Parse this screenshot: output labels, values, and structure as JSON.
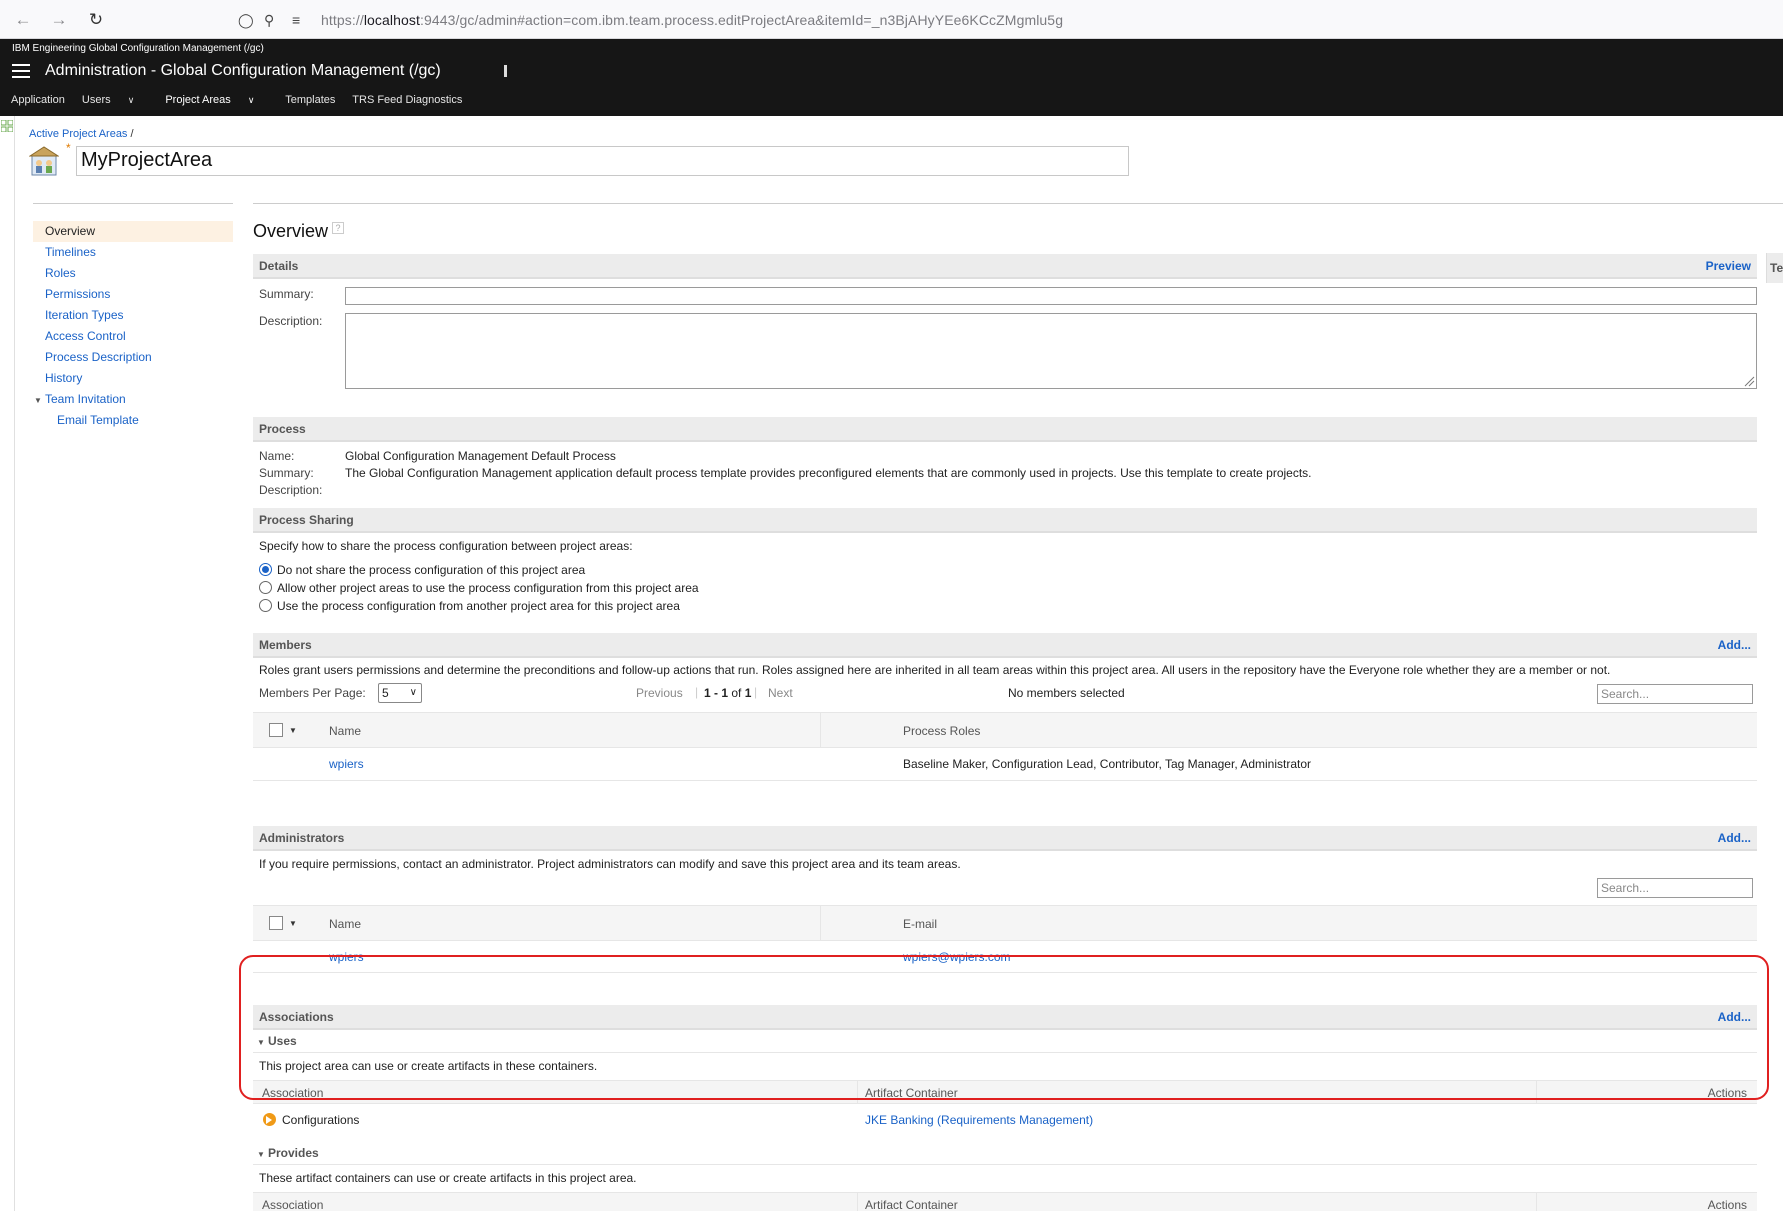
{
  "browser": {
    "url_prefix": "https://",
    "url_host": "localhost",
    "url_rest": ":9443/gc/admin#action=com.ibm.team.process.editProjectArea&itemId=_n3BjAHyYEe6KCcZMgmlu5g"
  },
  "header": {
    "product": "IBM Engineering Global Configuration Management (/gc)",
    "title": "Administration - Global Configuration Management (/gc)",
    "nav": {
      "application": "Application",
      "users": "Users",
      "project_areas": "Project Areas",
      "templates": "Templates",
      "trs": "TRS Feed Diagnostics"
    }
  },
  "breadcrumb": {
    "link": "Active Project Areas",
    "sep": "/"
  },
  "project_area": {
    "name": "MyProjectArea",
    "required_mark": "*"
  },
  "sidebar": {
    "overview": "Overview",
    "timelines": "Timelines",
    "roles": "Roles",
    "permissions": "Permissions",
    "iteration_types": "Iteration Types",
    "access_control": "Access Control",
    "process_description": "Process Description",
    "history": "History",
    "team_invitation": "Team Invitation",
    "email_template": "Email Template"
  },
  "overview": {
    "heading": "Overview",
    "help": "?",
    "truncated_tab": "Te"
  },
  "details": {
    "title": "Details",
    "preview": "Preview",
    "summary_label": "Summary:",
    "summary_value": "",
    "description_label": "Description:",
    "description_value": ""
  },
  "process": {
    "title": "Process",
    "name_label": "Name:",
    "name_value": "Global Configuration Management Default Process",
    "summary_label": "Summary:",
    "summary_value": "The Global Configuration Management application default process template provides preconfigured elements that are commonly used in projects. Use this template to create projects.",
    "description_label": "Description:"
  },
  "process_sharing": {
    "title": "Process Sharing",
    "intro": "Specify how to share the process configuration between project areas:",
    "option1": "Do not share the process configuration of this project area",
    "option2": "Allow other project areas to use the process configuration from this project area",
    "option3": "Use the process configuration from another project area for this project area",
    "selected": 1
  },
  "members": {
    "title": "Members",
    "add": "Add...",
    "intro": "Roles grant users permissions and determine the preconditions and follow-up actions that run. Roles assigned here are inherited in all team areas within this project area. All users in the repository have the Everyone role whether they are a member or not.",
    "per_page_label": "Members Per Page:",
    "per_page_value": "5",
    "previous": "Previous",
    "range": "1 - 1",
    "of": "of",
    "total": "1",
    "next": "Next",
    "selection": "No members selected",
    "search_placeholder": "Search...",
    "col_name": "Name",
    "col_roles": "Process Roles",
    "rows": [
      {
        "name": "wpiers",
        "roles": "Baseline Maker, Configuration Lead, Contributor, Tag Manager, Administrator"
      }
    ]
  },
  "administrators": {
    "title": "Administrators",
    "add": "Add...",
    "intro": "If you require permissions, contact an administrator. Project administrators can modify and save this project area and its team areas.",
    "search_placeholder": "Search...",
    "col_name": "Name",
    "col_email": "E-mail",
    "rows": [
      {
        "name": "wpiers",
        "email": "wpiers@wpiers.com"
      }
    ]
  },
  "associations": {
    "title": "Associations",
    "add": "Add...",
    "uses": {
      "title": "Uses",
      "intro": "This project area can use or create artifacts in these containers.",
      "col_association": "Association",
      "col_container": "Artifact Container",
      "col_actions": "Actions",
      "rows": [
        {
          "association": "Configurations",
          "container": "JKE Banking (Requirements Management)",
          "icon": "configuration-icon"
        }
      ]
    },
    "provides": {
      "title": "Provides",
      "intro": "These artifact containers can use or create artifacts in this project area.",
      "col_association": "Association",
      "col_container": "Artifact Container",
      "col_actions": "Actions"
    }
  },
  "colors": {
    "highlight": "#e02020",
    "link": "#1a62c7",
    "header_bg": "#161616"
  }
}
